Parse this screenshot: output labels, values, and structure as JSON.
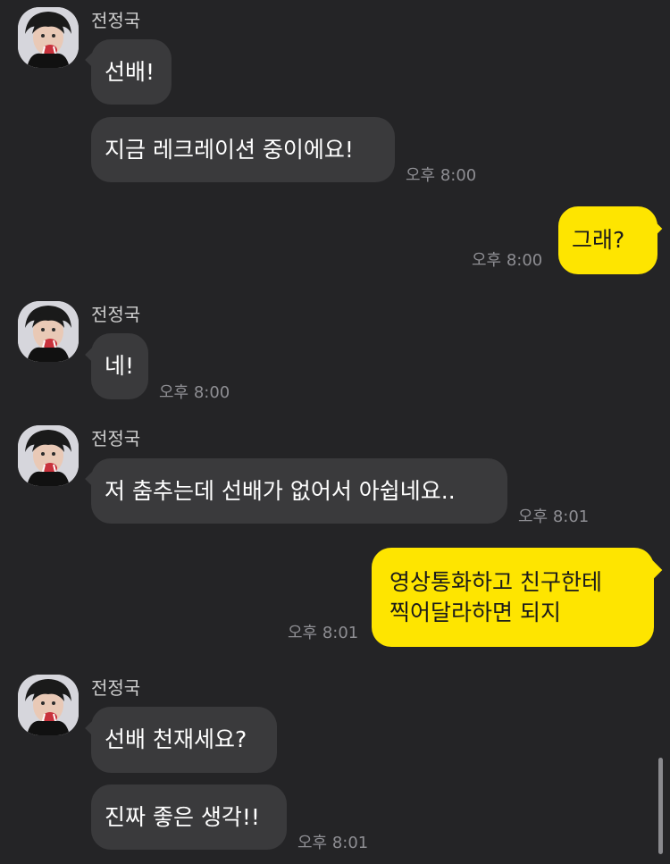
{
  "chat": {
    "sender_name": "전정국",
    "groups": [
      {
        "sender": "전정국",
        "messages": [
          "선배!",
          "지금 레크레이션 중이에요!"
        ],
        "time": "오후 8:00"
      },
      {
        "sender": "me",
        "messages": [
          "그래?"
        ],
        "time": "오후 8:00"
      },
      {
        "sender": "전정국",
        "messages": [
          "네!"
        ],
        "time": "오후 8:00"
      },
      {
        "sender": "전정국",
        "messages": [
          "저 춤추는데 선배가 없어서 아쉽네요.."
        ],
        "time": "오후 8:01"
      },
      {
        "sender": "me",
        "messages": [
          "영상통화하고 친구한테",
          "찍어달라하면 되지"
        ],
        "time": "오후 8:01"
      },
      {
        "sender": "전정국",
        "messages": [
          "선배 천재세요?",
          "진짜 좋은 생각!!"
        ],
        "time": "오후 8:01"
      }
    ]
  },
  "colors": {
    "background": "#242426",
    "incoming_bubble": "#3a3a3c",
    "outgoing_bubble": "#fee500",
    "timestamp": "#8e8e93"
  },
  "icons": {
    "avatar": "profile-photo"
  }
}
